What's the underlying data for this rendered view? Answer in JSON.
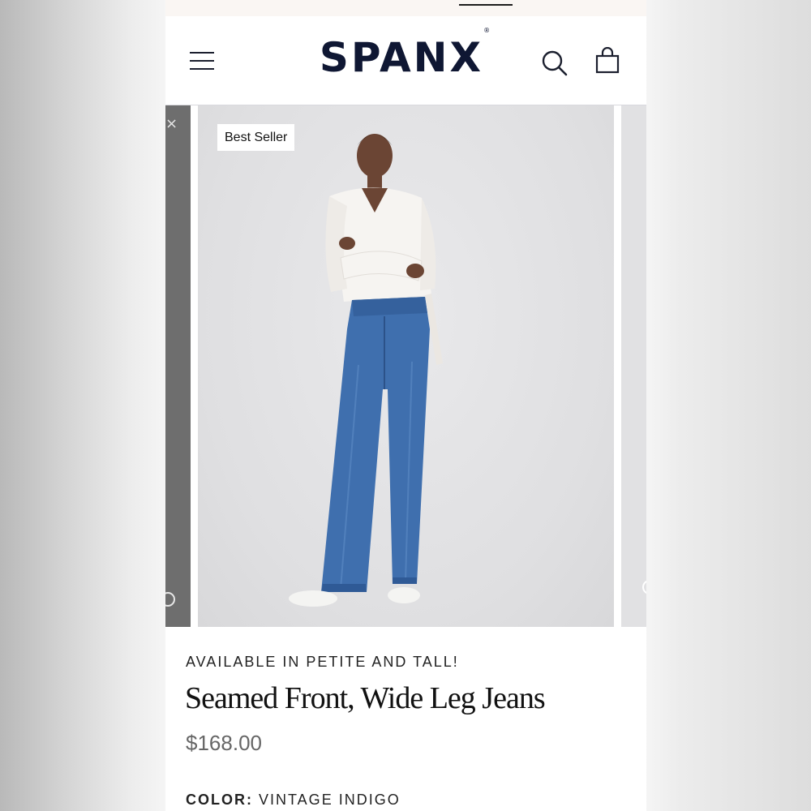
{
  "header": {
    "logo": "SPANX",
    "logo_mark": "®",
    "icons": {
      "menu": "hamburger-menu-icon",
      "search": "search-icon",
      "bag": "shopping-bag-icon"
    }
  },
  "gallery": {
    "badge": "Best Seller",
    "active_slide_image": "model wearing white wrap top and wide leg jeans"
  },
  "product": {
    "promo": "AVAILABLE IN PETITE AND TALL!",
    "title": "Seamed Front, Wide Leg Jeans",
    "price": "$168.00",
    "color_label": "COLOR:",
    "color_value": "VINTAGE INDIGO"
  },
  "colors": {
    "brand": "#0f1733",
    "denim": "#3f6fae",
    "price": "#666666"
  }
}
